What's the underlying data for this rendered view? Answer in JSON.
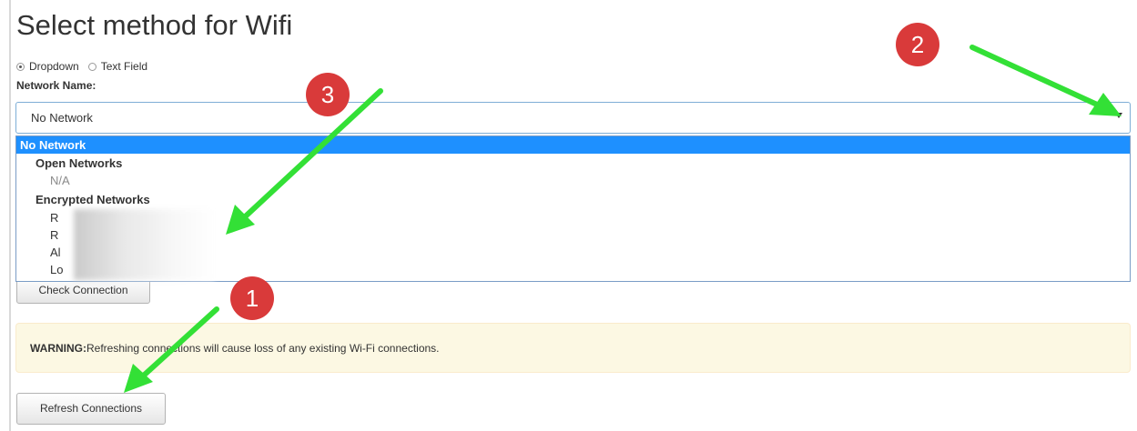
{
  "page": {
    "title": "Select method for Wifi"
  },
  "method": {
    "options": [
      "Dropdown",
      "Text Field"
    ],
    "selected": "Dropdown"
  },
  "network": {
    "label": "Network Name:",
    "selected_value": "No Network",
    "dropdown": {
      "selected_option": "No Network",
      "open_group_label": "Open Networks",
      "open_items": [
        "N/A"
      ],
      "encrypted_group_label": "Encrypted Networks",
      "encrypted_items": [
        "R",
        "R",
        "Al",
        "Lo"
      ]
    }
  },
  "buttons": {
    "check_connection": "Check Connection",
    "refresh_connections": "Refresh Connections"
  },
  "warning": {
    "label": "WARNING:",
    "text": "Refreshing connections will cause loss of any existing Wi-Fi connections."
  },
  "annotations": {
    "badges": [
      "1",
      "2",
      "3"
    ],
    "badge_color": "#d93a3a",
    "arrow_color": "#33e036"
  },
  "icons": {
    "radio": "radio-button-icon",
    "dropdown_arrow": "chevron-down-icon"
  },
  "colors": {
    "selected_option_bg": "#1e90ff",
    "warning_bg": "#fcf8e3",
    "select_border": "#7eaed6"
  }
}
